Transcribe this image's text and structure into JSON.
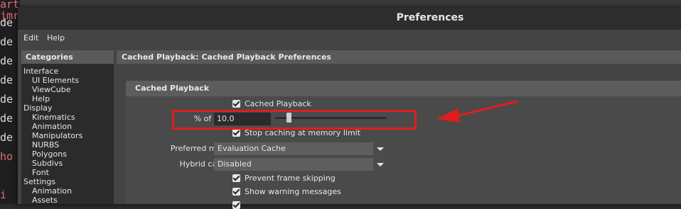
{
  "background": {
    "code_lines": [
      {
        "text": "arty jmr",
        "color": "#e06c75"
      },
      {
        "text": "de",
        "color": "#dcdcdc"
      },
      {
        "text": "de",
        "color": "#dcdcdc"
      },
      {
        "text": "de",
        "color": "#dcdcdc"
      },
      {
        "text": "de",
        "color": "#dcdcdc"
      },
      {
        "text": "de",
        "color": "#dcdcdc"
      },
      {
        "text": "de",
        "color": "#dcdcdc"
      },
      {
        "text": "de",
        "color": "#dcdcdc"
      },
      {
        "text": "ho",
        "color": "#e06c75"
      },
      {
        "text": "i",
        "color": "#e06c75"
      }
    ]
  },
  "window": {
    "title": "Preferences",
    "menu": [
      "Edit",
      "Help"
    ]
  },
  "categories": {
    "header": "Categories",
    "items": [
      {
        "label": "Interface",
        "sub": false
      },
      {
        "label": "UI Elements",
        "sub": true
      },
      {
        "label": "ViewCube",
        "sub": true
      },
      {
        "label": "Help",
        "sub": true
      },
      {
        "label": "Display",
        "sub": false
      },
      {
        "label": "Kinematics",
        "sub": true
      },
      {
        "label": "Animation",
        "sub": true
      },
      {
        "label": "Manipulators",
        "sub": true
      },
      {
        "label": "NURBS",
        "sub": true
      },
      {
        "label": "Polygons",
        "sub": true
      },
      {
        "label": "Subdivs",
        "sub": true
      },
      {
        "label": "Font",
        "sub": true
      },
      {
        "label": "Settings",
        "sub": false
      },
      {
        "label": "Animation",
        "sub": true
      },
      {
        "label": "Assets",
        "sub": true
      }
    ]
  },
  "main": {
    "header": "Cached Playback: Cached Playback Preferences",
    "section_title": "Cached Playback",
    "cached_playback": {
      "label": "Cached Playback",
      "checked": true
    },
    "ram": {
      "label": "% of RAM",
      "value": "10.0",
      "slider_fraction": 0.1
    },
    "stop_caching": {
      "label": "Stop caching at memory limit",
      "checked": true
    },
    "preferred_mode": {
      "label": "Preferred mode",
      "value": "Evaluation Cache"
    },
    "hybrid_cache": {
      "label": "Hybrid cache",
      "value": "Disabled"
    },
    "prevent_skipping": {
      "label": "Prevent frame skipping",
      "checked": true
    },
    "show_warnings": {
      "label": "Show warning messages",
      "checked": true
    }
  },
  "annotation": {
    "color": "#e01d1d"
  }
}
